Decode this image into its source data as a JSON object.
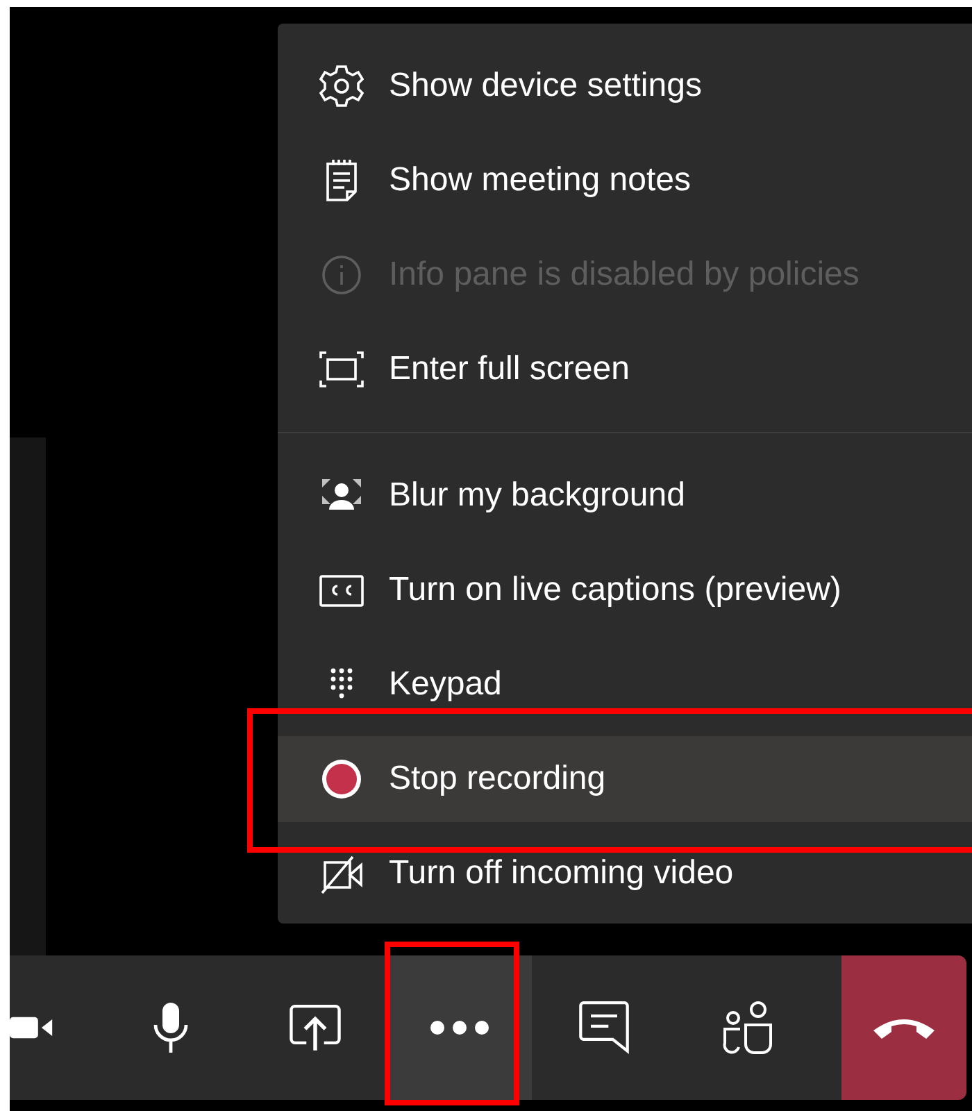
{
  "menu": {
    "groups": [
      {
        "items": [
          {
            "kind": "gear",
            "label": "Show device settings",
            "disabled": false,
            "selected": false,
            "annotated": false
          },
          {
            "kind": "notes",
            "label": "Show meeting notes",
            "disabled": false,
            "selected": false,
            "annotated": false
          },
          {
            "kind": "info",
            "label": "Info pane is disabled by policies",
            "disabled": true,
            "selected": false,
            "annotated": false
          },
          {
            "kind": "fullscreen",
            "label": "Enter full screen",
            "disabled": false,
            "selected": false,
            "annotated": false
          }
        ]
      },
      {
        "items": [
          {
            "kind": "blur",
            "label": "Blur my background",
            "disabled": false,
            "selected": false,
            "annotated": false
          },
          {
            "kind": "captions",
            "label": "Turn on live captions (preview)",
            "disabled": false,
            "selected": false,
            "annotated": false
          },
          {
            "kind": "keypad",
            "label": "Keypad",
            "disabled": false,
            "selected": false,
            "annotated": false
          },
          {
            "kind": "record",
            "label": "Stop recording",
            "disabled": false,
            "selected": true,
            "annotated": true
          },
          {
            "kind": "videooff",
            "label": "Turn off incoming video",
            "disabled": false,
            "selected": false,
            "annotated": false
          }
        ]
      }
    ]
  },
  "toolbar": [
    {
      "kind": "camera",
      "selected": false,
      "annotated": false
    },
    {
      "kind": "mic",
      "selected": false,
      "annotated": false
    },
    {
      "kind": "share",
      "selected": false,
      "annotated": false
    },
    {
      "kind": "more",
      "selected": true,
      "annotated": true
    },
    {
      "kind": "chat",
      "selected": false,
      "annotated": false
    },
    {
      "kind": "people",
      "selected": false,
      "annotated": false
    },
    {
      "kind": "hangup",
      "selected": false,
      "annotated": false
    }
  ]
}
